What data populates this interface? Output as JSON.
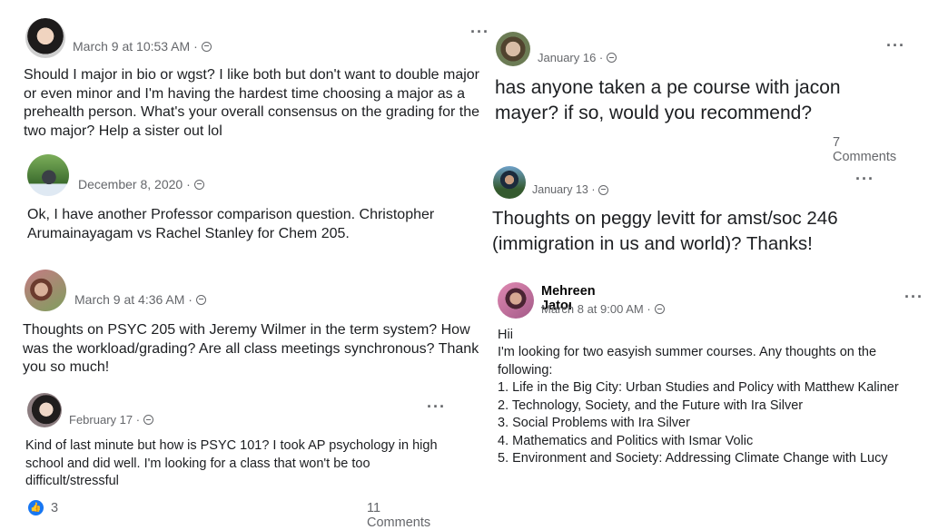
{
  "posts_left": [
    {
      "meta": "March 9 at 10:53 AM ·",
      "text": "Should I major in bio or wgst? I like both but don't want to double major or even minor and I'm having the hardest time choosing a major as a prehealth person. What's your overall consensus on the grading for the two major? Help a sister out lol"
    },
    {
      "meta": "December 8, 2020 ·",
      "text": "Ok, I have another Professor comparison question. Christopher Arumainayagam vs Rachel Stanley for Chem 205."
    },
    {
      "meta": "March 9 at 4:36 AM ·",
      "text": "Thoughts on PSYC 205 with Jeremy Wilmer in the term system? How was the workload/grading? Are all class meetings synchronous? Thank you so much!"
    },
    {
      "meta": "February 17 ·",
      "text": "Kind of last minute but how is PSYC 101? I took AP psychology in high school and did well. I'm looking for a class that won't be too difficult/stressful",
      "likes": "3",
      "comments": "11 Comments"
    }
  ],
  "posts_right": [
    {
      "meta": "January 16 ·",
      "text": "has anyone taken a pe course with jacon mayer? if so, would you recommend?",
      "comments": "7 Comments"
    },
    {
      "meta": "January 13 ·",
      "text": "Thoughts on peggy levitt for amst/soc 246 (immigration in us and world)? Thanks!"
    },
    {
      "name": "Mehreen Jatoı",
      "meta": "March 8 at 9:00 AM ·",
      "greeting": "Hii",
      "intro": "I'm looking for two easyish summer courses. Any thoughts on the following:",
      "list": [
        "1. Life in the Big City: Urban Studies and Policy with Matthew Kaliner",
        "2. Technology, Society, and the Future with Ira Silver",
        "3. Social Problems with Ira Silver",
        "4. Mathematics and Politics with Ismar Volic",
        "5. Environment and Society: Addressing Climate Change with Lucy"
      ]
    }
  ],
  "icons": {
    "more": "more-options-icon",
    "privacy": "globe-icon",
    "like": "like-icon"
  },
  "colors": {
    "meta": "#65676b",
    "like": "#1877f2",
    "text": "#1c1e21"
  }
}
